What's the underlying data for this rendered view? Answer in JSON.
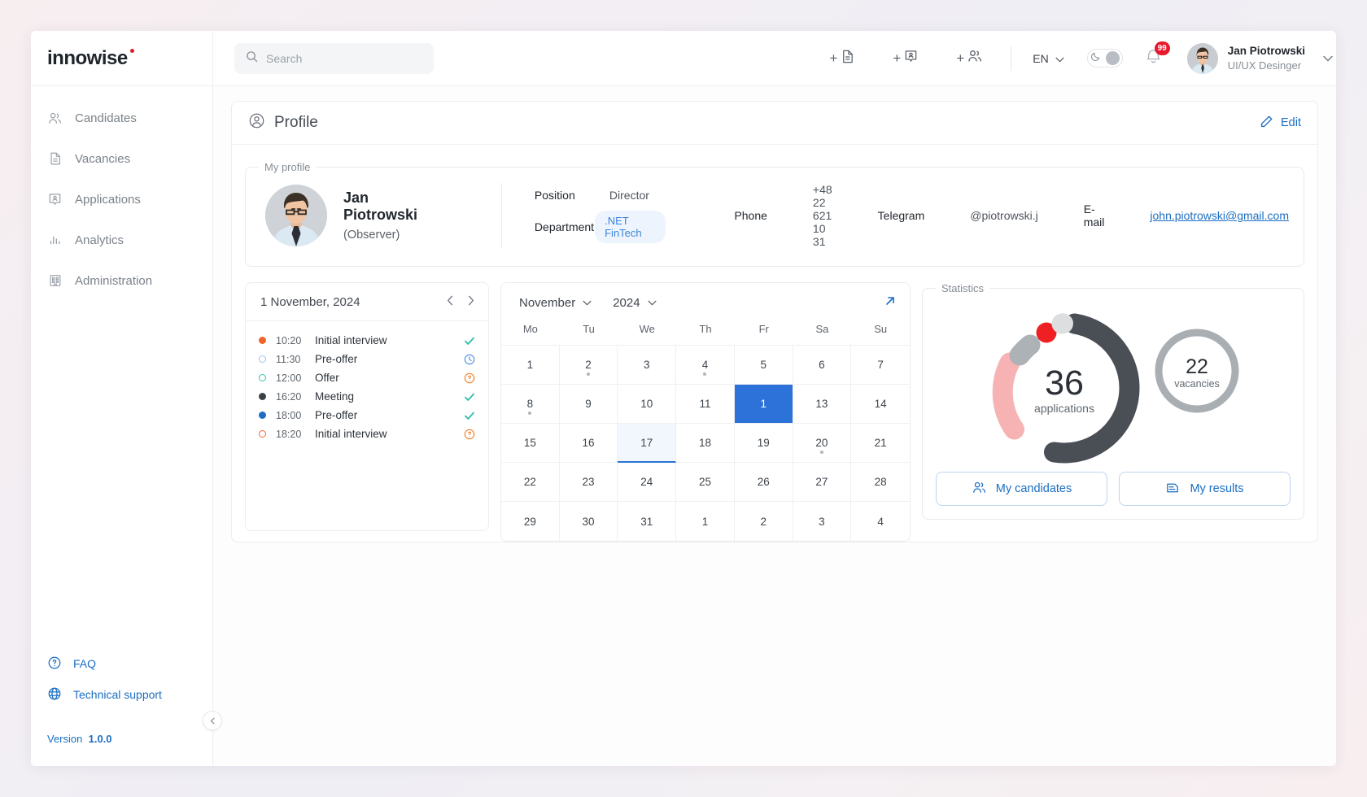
{
  "header": {
    "logo": "innowise",
    "search_placeholder": "Search",
    "quick_actions": [
      {
        "name": "add-document",
        "label": "+"
      },
      {
        "name": "add-application",
        "label": "+"
      },
      {
        "name": "add-candidate",
        "label": "+"
      }
    ],
    "language": "EN",
    "notifications_count": "99",
    "user": {
      "name": "Jan Piotrowski",
      "role": "UI/UX Desinger"
    }
  },
  "sidebar": {
    "items": [
      {
        "label": "Candidates",
        "icon": "people-icon"
      },
      {
        "label": "Vacancies",
        "icon": "document-icon"
      },
      {
        "label": "Applications",
        "icon": "application-icon"
      },
      {
        "label": "Analytics",
        "icon": "bar-chart-icon"
      },
      {
        "label": "Administration",
        "icon": "building-icon"
      }
    ],
    "help": [
      {
        "label": "FAQ",
        "icon": "question-circle-icon"
      },
      {
        "label": "Technical support",
        "icon": "globe-icon"
      }
    ],
    "version_label": "Version",
    "version_value": "1.0.0"
  },
  "page": {
    "title": "Profile",
    "edit_label": "Edit"
  },
  "profile": {
    "legend": "My profile",
    "name": "Jan Piotrowski",
    "role": "(Observer)",
    "position_label": "Position",
    "position_value": "Director",
    "department_label": "Department",
    "department_value": ".NET FinTech",
    "phone_label": "Phone",
    "phone_value": "+48 22 621 10 31",
    "telegram_label": "Telegram",
    "telegram_value": "@piotrowski.j",
    "email_label": "E-mail",
    "email_value": "john.piotrowski@gmail.com"
  },
  "events": {
    "date": "1 November, 2024",
    "prev": "‹",
    "next": "›",
    "items": [
      {
        "time": "10:20",
        "title": "Initial interview",
        "dot_color": "#f2652a",
        "dot_style": "filled",
        "status": "check"
      },
      {
        "time": "11:30",
        "title": "Pre-offer",
        "dot_color": "#9fc0ee",
        "dot_style": "ring",
        "status": "clock"
      },
      {
        "time": "12:00",
        "title": "Offer",
        "dot_color": "#35c0ab",
        "dot_style": "ring",
        "status": "question"
      },
      {
        "time": "16:20",
        "title": "Meeting",
        "dot_color": "#3a4148",
        "dot_style": "filled",
        "status": "check"
      },
      {
        "time": "18:00",
        "title": "Pre-offer",
        "dot_color": "#1b6ec2",
        "dot_style": "filled",
        "status": "check"
      },
      {
        "time": "18:20",
        "title": "Initial interview",
        "dot_color": "#f2652a",
        "dot_style": "ring",
        "status": "question"
      }
    ]
  },
  "calendar": {
    "month": "November",
    "year": "2024",
    "dow": [
      "Mo",
      "Tu",
      "We",
      "Th",
      "Fr",
      "Sa",
      "Su"
    ],
    "weeks": [
      [
        {
          "d": "1"
        },
        {
          "d": "2",
          "mark": true
        },
        {
          "d": "3"
        },
        {
          "d": "4",
          "mark": true
        },
        {
          "d": "5"
        },
        {
          "d": "6"
        },
        {
          "d": "7"
        }
      ],
      [
        {
          "d": "8",
          "mark": true
        },
        {
          "d": "9"
        },
        {
          "d": "10"
        },
        {
          "d": "11"
        },
        {
          "d": "1",
          "selected": true
        },
        {
          "d": "13"
        },
        {
          "d": "14"
        }
      ],
      [
        {
          "d": "15"
        },
        {
          "d": "16"
        },
        {
          "d": "17",
          "today": true
        },
        {
          "d": "18"
        },
        {
          "d": "19"
        },
        {
          "d": "20",
          "mark": true
        },
        {
          "d": "21"
        }
      ],
      [
        {
          "d": "22"
        },
        {
          "d": "23"
        },
        {
          "d": "24"
        },
        {
          "d": "25"
        },
        {
          "d": "26"
        },
        {
          "d": "27"
        },
        {
          "d": "28"
        }
      ],
      [
        {
          "d": "29"
        },
        {
          "d": "30"
        },
        {
          "d": "31"
        },
        {
          "d": "1"
        },
        {
          "d": "2"
        },
        {
          "d": "3"
        },
        {
          "d": "4"
        }
      ]
    ]
  },
  "statistics": {
    "legend": "Statistics",
    "buttons": [
      {
        "label": "My candidates",
        "icon": "people-icon"
      },
      {
        "label": "My results",
        "icon": "results-icon"
      }
    ]
  },
  "chart_data": [
    {
      "type": "pie",
      "title": "applications",
      "center_value": "36",
      "center_label": "applications",
      "total": 36,
      "categories": [
        "dark",
        "pink",
        "gray",
        "red",
        "light-gray"
      ],
      "values": [
        18,
        9,
        4,
        3,
        2
      ],
      "colors": [
        "#4a4f55",
        "#f7b3b3",
        "#adb2b7",
        "#ee2024",
        "#dcdee0"
      ],
      "legend": "none"
    },
    {
      "type": "pie",
      "title": "vacancies",
      "center_value": "22",
      "center_label": "vacancies",
      "total": 22,
      "categories": [
        "all"
      ],
      "values": [
        22
      ],
      "colors": [
        "#a9aeb3"
      ],
      "legend": "none"
    }
  ]
}
